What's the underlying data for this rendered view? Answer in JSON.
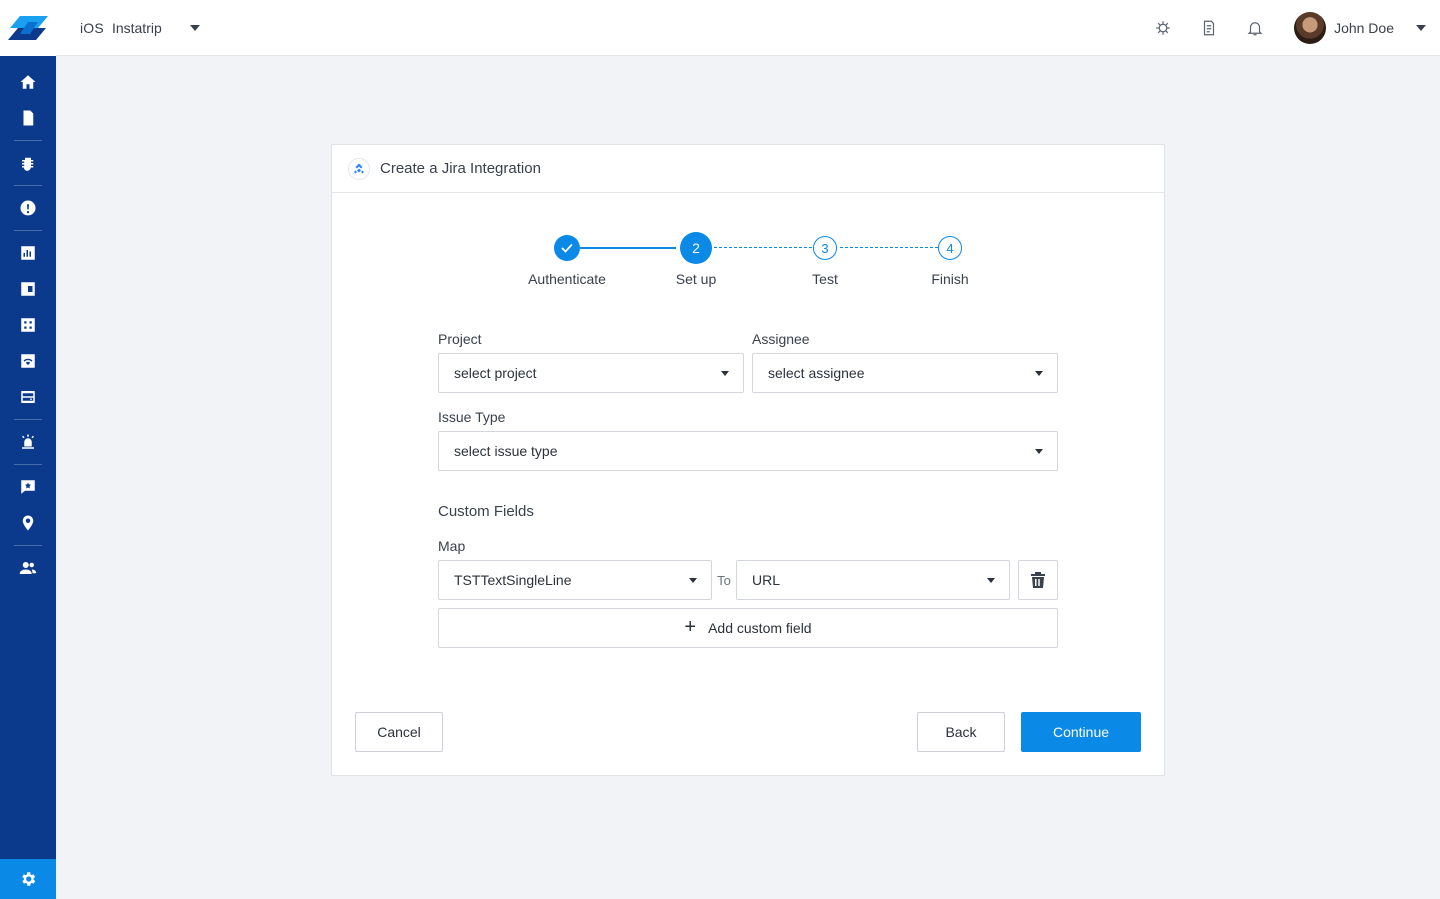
{
  "topbar": {
    "platform": "iOS",
    "app_name": "Instatrip",
    "user_name": "John Doe"
  },
  "card": {
    "title": "Create a Jira Integration"
  },
  "stepper": {
    "steps": [
      {
        "number": "1",
        "label": "Authenticate",
        "state": "done"
      },
      {
        "number": "2",
        "label": "Set up",
        "state": "active"
      },
      {
        "number": "3",
        "label": "Test",
        "state": "todo"
      },
      {
        "number": "4",
        "label": "Finish",
        "state": "todo"
      }
    ]
  },
  "form": {
    "project_label": "Project",
    "project_value": "select project",
    "assignee_label": "Assignee",
    "assignee_value": "select assignee",
    "issue_type_label": "Issue Type",
    "issue_type_value": "select issue type",
    "custom_fields_title": "Custom Fields",
    "map_label": "Map",
    "map_source": "TSTTextSingleLine",
    "map_to": "To",
    "map_target": "URL",
    "add_custom_field": "Add custom field"
  },
  "footer": {
    "cancel": "Cancel",
    "back": "Back",
    "continue": "Continue"
  },
  "colors": {
    "sidebar": "#0b3a8c",
    "accent": "#0b89e6"
  }
}
